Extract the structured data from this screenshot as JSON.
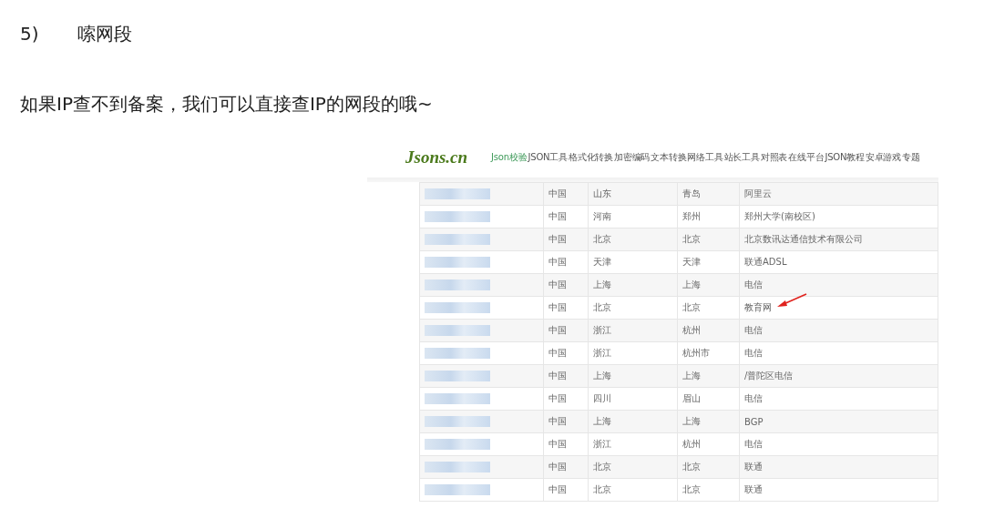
{
  "heading": {
    "number": "5)",
    "title": "嗦网段"
  },
  "paragraph": "如果IP查不到备案，我们可以直接查IP的网段的哦~",
  "screenshot": {
    "logo": "Jsons.cn",
    "nav": [
      {
        "label": "Json校验",
        "selected": true
      },
      {
        "label": "JSON工具",
        "selected": false
      },
      {
        "label": "格式化转换",
        "selected": false
      },
      {
        "label": "加密编码",
        "selected": false
      },
      {
        "label": "文本转换",
        "selected": false
      },
      {
        "label": "网络工具",
        "selected": false
      },
      {
        "label": "站长工具",
        "selected": false
      },
      {
        "label": "对照表",
        "selected": false
      },
      {
        "label": "在线平台",
        "selected": false
      },
      {
        "label": "JSON教程",
        "selected": false
      },
      {
        "label": "安卓游戏",
        "selected": false
      },
      {
        "label": "专题",
        "selected": false
      }
    ],
    "rows": [
      {
        "ip_blurred": true,
        "country": "中国",
        "province": "山东",
        "city": "青岛",
        "isp": "阿里云",
        "marked": false
      },
      {
        "ip_blurred": true,
        "country": "中国",
        "province": "河南",
        "city": "郑州",
        "isp": "郑州大学(南校区)",
        "marked": false
      },
      {
        "ip_blurred": true,
        "country": "中国",
        "province": "北京",
        "city": "北京",
        "isp": "北京数讯达通信技术有限公司",
        "marked": false
      },
      {
        "ip_blurred": true,
        "country": "中国",
        "province": "天津",
        "city": "天津",
        "isp": "联通ADSL",
        "marked": false
      },
      {
        "ip_blurred": true,
        "country": "中国",
        "province": "上海",
        "city": "上海",
        "isp": "电信",
        "marked": false
      },
      {
        "ip_blurred": true,
        "country": "中国",
        "province": "北京",
        "city": "北京",
        "isp": "教育网",
        "marked": true
      },
      {
        "ip_blurred": true,
        "country": "中国",
        "province": "浙江",
        "city": "杭州",
        "isp": "电信",
        "marked": false
      },
      {
        "ip_blurred": true,
        "country": "中国",
        "province": "浙江",
        "city": "杭州市",
        "isp": "电信",
        "marked": false
      },
      {
        "ip_blurred": true,
        "country": "中国",
        "province": "上海",
        "city": "上海",
        "isp": "/普陀区电信",
        "marked": false
      },
      {
        "ip_blurred": true,
        "country": "中国",
        "province": "四川",
        "city": "眉山",
        "isp": "电信",
        "marked": false
      },
      {
        "ip_blurred": true,
        "country": "中国",
        "province": "上海",
        "city": "上海",
        "isp": "BGP",
        "marked": false
      },
      {
        "ip_blurred": true,
        "country": "中国",
        "province": "浙江",
        "city": "杭州",
        "isp": "电信",
        "marked": false
      },
      {
        "ip_blurred": true,
        "country": "中国",
        "province": "北京",
        "city": "北京",
        "isp": "联通",
        "marked": false
      },
      {
        "ip_blurred": true,
        "country": "中国",
        "province": "北京",
        "city": "北京",
        "isp": "联通",
        "marked": false
      }
    ]
  }
}
